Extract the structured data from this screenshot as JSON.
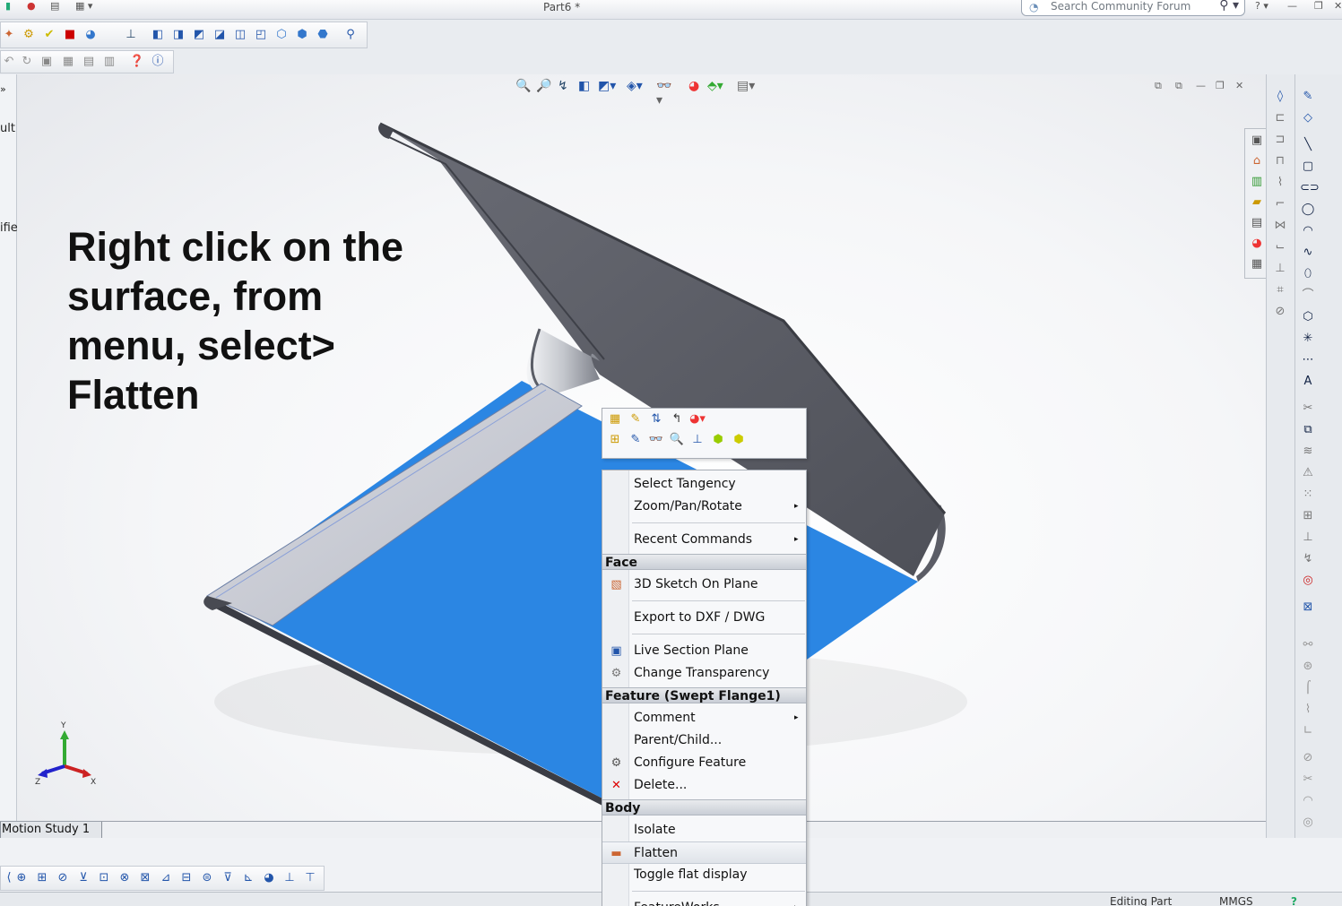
{
  "window": {
    "title": "Part6 *",
    "search_placeholder": "Search Community Forum"
  },
  "viewport": {
    "instruction_lines": [
      "Right click on the",
      "surface, from",
      "menu, select>",
      "Flatten"
    ],
    "left_panel_fragments": [
      "ult",
      "ifie"
    ],
    "triad_labels": {
      "x": "X",
      "y": "Y",
      "z": "Z"
    }
  },
  "context_menu": {
    "items_top": [
      {
        "label": "Select Tangency",
        "submenu": false
      },
      {
        "label": "Zoom/Pan/Rotate",
        "submenu": true
      },
      {
        "label": "Recent Commands",
        "submenu": true
      }
    ],
    "face_header": "Face",
    "face_items": [
      {
        "label": "3D Sketch On Plane",
        "icon": "sketch-plane-icon"
      },
      {
        "label": "Export to DXF / DWG",
        "icon": ""
      },
      {
        "label": "Live Section Plane",
        "icon": "section-plane-icon"
      },
      {
        "label": "Change Transparency",
        "icon": "transparency-icon"
      }
    ],
    "feature_header": "Feature (Swept Flange1)",
    "feature_items": [
      {
        "label": "Comment",
        "submenu": true
      },
      {
        "label": "Parent/Child...",
        "submenu": false
      },
      {
        "label": "Configure Feature",
        "icon": "configure-feature-icon"
      },
      {
        "label": "Delete...",
        "icon": "delete-icon"
      }
    ],
    "body_header": "Body",
    "body_items": [
      {
        "label": "Isolate"
      },
      {
        "label": "Flatten",
        "highlighted": true,
        "icon": "flatten-icon"
      },
      {
        "label": "Toggle flat display"
      },
      {
        "label": "FeatureWorks",
        "submenu": true
      }
    ]
  },
  "bottom": {
    "motion_tab": "Motion Study 1",
    "status_editing": "Editing Part",
    "status_units": "MMGS",
    "help": "?"
  },
  "colors": {
    "face_blue": "#2b86e3",
    "sheet_grey": "#54565e",
    "menu_header": "#cfd3da"
  }
}
